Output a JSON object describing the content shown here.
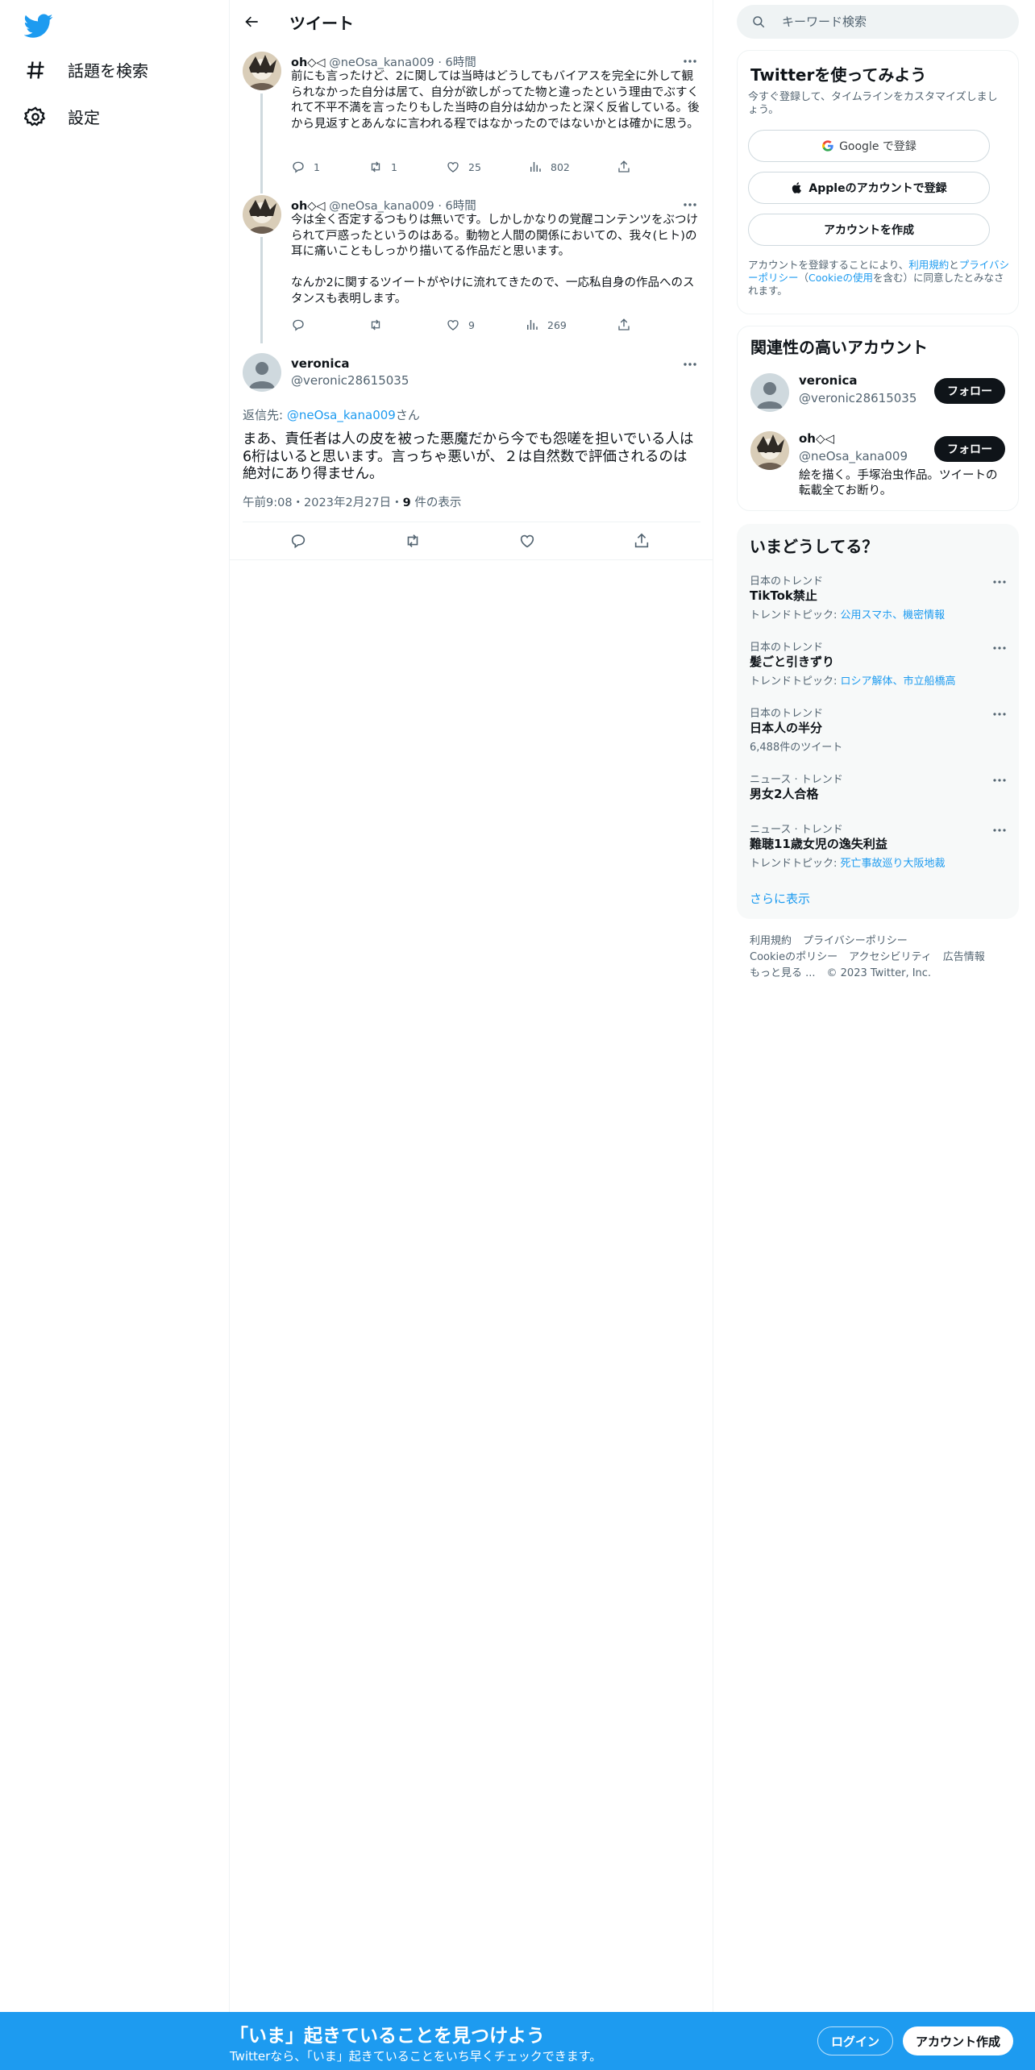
{
  "nav": {
    "explore_label": "話題を検索",
    "settings_label": "設定"
  },
  "header": {
    "title": "ツイート"
  },
  "thread": [
    {
      "name": "oh◇◁",
      "handle": "@neOsa_kana009",
      "time": "6時間",
      "text": "前にも言ったけど、2に関しては当時はどうしてもバイアスを完全に外して観られなかった自分は居て、自分が欲しがってた物と違ったという理由でぶすくれて不平不満を言ったりもした当時の自分は幼かったと深く反省している。後から見返すとあんなに言われる程ではなかったのではないかとは確かに思う。",
      "replies": "1",
      "retweets": "1",
      "likes": "25",
      "views": "802"
    },
    {
      "name": "oh◇◁",
      "handle": "@neOsa_kana009",
      "time": "6時間",
      "text": "今は全く否定するつもりは無いです。しかしかなりの覚醒コンテンツをぶつけられて戸惑ったというのはある。動物と人間の関係においての、我々(ヒト)の耳に痛いこともしっかり描いてる作品だと思います。\n\nなんか2に関するツイートがやけに流れてきたので、一応私自身の作品へのスタンスも表明します。",
      "replies": "",
      "retweets": "",
      "likes": "9",
      "views": "269"
    }
  ],
  "focus": {
    "name": "veronica",
    "handle": "@veronic28615035",
    "reply_prefix": "返信先: ",
    "reply_to": "@neOsa_kana009",
    "reply_suffix": "さん",
    "text": "まあ、責任者は人の皮を被った悪魔だから今でも怨嗟を担いでいる人は6桁はいると思います。言っちゃ悪いが、２は自然数で評価されるのは絶対にあり得ません。",
    "timestamp": "午前9:08・2023年2月27日・",
    "views_count": "9",
    "views_label": " 件の表示"
  },
  "search": {
    "placeholder": "キーワード検索"
  },
  "signup_card": {
    "title": "Twitterを使ってみよう",
    "subtitle": "今すぐ登録して、タイムラインをカスタマイズしましょう。",
    "google_label": "Google で登録",
    "apple_label": "Appleのアカウントで登録",
    "create_label": "アカウントを作成",
    "legal_1": "アカウントを登録することにより、",
    "legal_terms": "利用規約",
    "legal_2": "と",
    "legal_privacy": "プライバシーポリシー",
    "legal_3": "（",
    "legal_cookie": "Cookieの使用",
    "legal_4": "を含む）に同意したとみなされます。"
  },
  "related": {
    "title": "関連性の高いアカウント",
    "accounts": [
      {
        "name": "veronica",
        "handle": "@veronic28615035",
        "bio": "",
        "follow_label": "フォロー"
      },
      {
        "name": "oh◇◁",
        "handle": "@neOsa_kana009",
        "bio": "絵を描く。手塚治虫作品。ツイートの転載全てお断り。",
        "follow_label": "フォロー"
      }
    ]
  },
  "trends": {
    "title": "いまどうしてる？",
    "items": [
      {
        "context": "日本のトレンド",
        "name": "TikTok禁止",
        "sub_label": "トレンドトピック: ",
        "sub_links": "公用スマホ、機密情報"
      },
      {
        "context": "日本のトレンド",
        "name": "髪ごと引きずり",
        "sub_label": "トレンドトピック: ",
        "sub_links": "ロシア解体、市立船橋高"
      },
      {
        "context": "日本のトレンド",
        "name": "日本人の半分",
        "sub_label": "6,488件のツイート",
        "sub_links": ""
      },
      {
        "context": "ニュース · トレンド",
        "name": "男女2人合格",
        "sub_label": "",
        "sub_links": ""
      },
      {
        "context": "ニュース · トレンド",
        "name": "難聴11歳女児の逸失利益",
        "sub_label": "トレンドトピック: ",
        "sub_links": "死亡事故巡り大阪地裁"
      }
    ],
    "show_more": "さらに表示"
  },
  "footer": {
    "terms": "利用規約",
    "privacy": "プライバシーポリシー",
    "cookie": "Cookieのポリシー",
    "accessibility": "アクセシビリティ",
    "ads": "広告情報",
    "more": "もっと見る ...",
    "copyright": "© 2023 Twitter, Inc."
  },
  "bottombar": {
    "title": "「いま」起きていることを見つけよう",
    "subtitle": "Twitterなら、「いま」起きていることをいち早くチェックできます。",
    "login_label": "ログイン",
    "signup_label": "アカウント作成"
  },
  "colors": {
    "accent": "#1d9bf0",
    "text": "#0f1419",
    "secondary": "#536471"
  }
}
